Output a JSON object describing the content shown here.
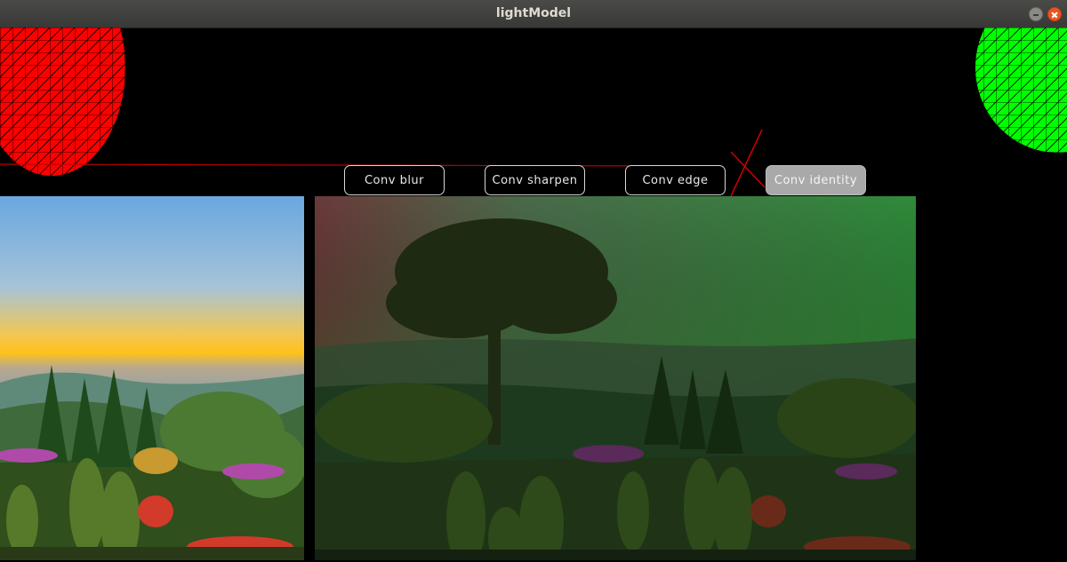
{
  "window": {
    "title": "lightModel"
  },
  "buttons": {
    "blur": "Conv blur",
    "sharpen": "Conv sharpen",
    "edge": "Conv edge",
    "identity": "Conv identity"
  },
  "colors": {
    "red_sphere": "#ff0000",
    "green_sphere": "#00ff00",
    "line": "#c00000",
    "active_button": "#a9a9a9"
  },
  "icons": [
    "minimize-icon",
    "close-icon"
  ]
}
